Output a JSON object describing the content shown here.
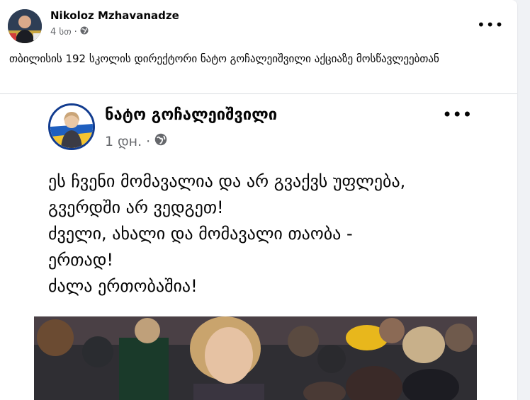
{
  "post": {
    "author": "Nikoloz Mzhavanadze",
    "time": "4 სთ",
    "privacy_icon": "globe-icon",
    "menu_icon": "more-icon",
    "caption": "თბილისის 192 სკოლის დირექტორი ნატო გოჩალეიშვილი აქციაზე მოსწავლეებთან"
  },
  "shared_post": {
    "author": "ნატო გოჩალეიშვილი",
    "time": "1 დн.",
    "privacy_icon": "globe-icon",
    "menu_icon": "more-icon",
    "lines": [
      "ეს ჩვენი მომავალია და არ გვაქვს უფლება,",
      "გვერდში არ ვედგეთ!",
      "ძველი, ახალი და მომავალი თაობა -",
      "ერთად!",
      "ძალა ერთობაშია!"
    ]
  },
  "colors": {
    "secondary_text": "#65676b",
    "divider": "#dadde1",
    "page_background": "#f0f2f5"
  }
}
